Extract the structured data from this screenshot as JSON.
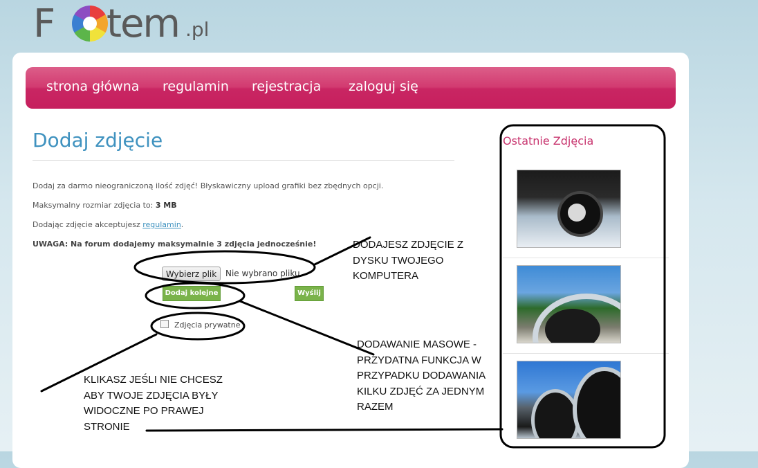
{
  "logo": {
    "text_left": "F",
    "text_right": "tem",
    "suffix": ".pl"
  },
  "nav": [
    "strona główna",
    "regulamin",
    "rejestracja",
    "zaloguj się"
  ],
  "main": {
    "title": "Dodaj zdjęcie",
    "intro": "Dodaj za darmo nieograniczoną ilość zdjęć! Błyskawiczny upload grafiki bez zbędnych opcji.",
    "max_size_label": "Maksymalny rozmiar zdjęcia to:",
    "max_size_value": "3 MB",
    "terms_prefix": "Dodając zdjęcie akceptujesz",
    "terms_link": "regulamin",
    "terms_suffix": ".",
    "warning": "UWAGA: Na forum dodajemy maksymalnie 3 zdjęcia jednocześnie!",
    "file_button": "Wybierz plik",
    "file_status": "Nie wybrano pliku.",
    "add_another": "Dodaj kolejne",
    "send": "Wyślij",
    "private_label": "Zdjęcia prywatne"
  },
  "annotations": {
    "a1": "DODAJESZ ZDJĘCIE Z DYSKU TWOJEGO KOMPUTERA",
    "a2": "DODAWANIE MASOWE - PRZYDATNA FUNKCJA W PRZYPADKU DODAWANIA KILKU ZDJĘĆ ZA JEDNYM RAZEM",
    "a3": "KLIKASZ JEŚLI NIE CHCESZ ABY TWOJE ZDJĘCIA BYŁY WIDOCZNE PO PRAWEJ STRONIE"
  },
  "sidebar": {
    "title": "Ostatnie Zdjęcia"
  },
  "colors": {
    "nav": "#c8346e",
    "title": "#3f92bf",
    "button": "#7ab34a",
    "sidebar_title": "#c8346e"
  }
}
